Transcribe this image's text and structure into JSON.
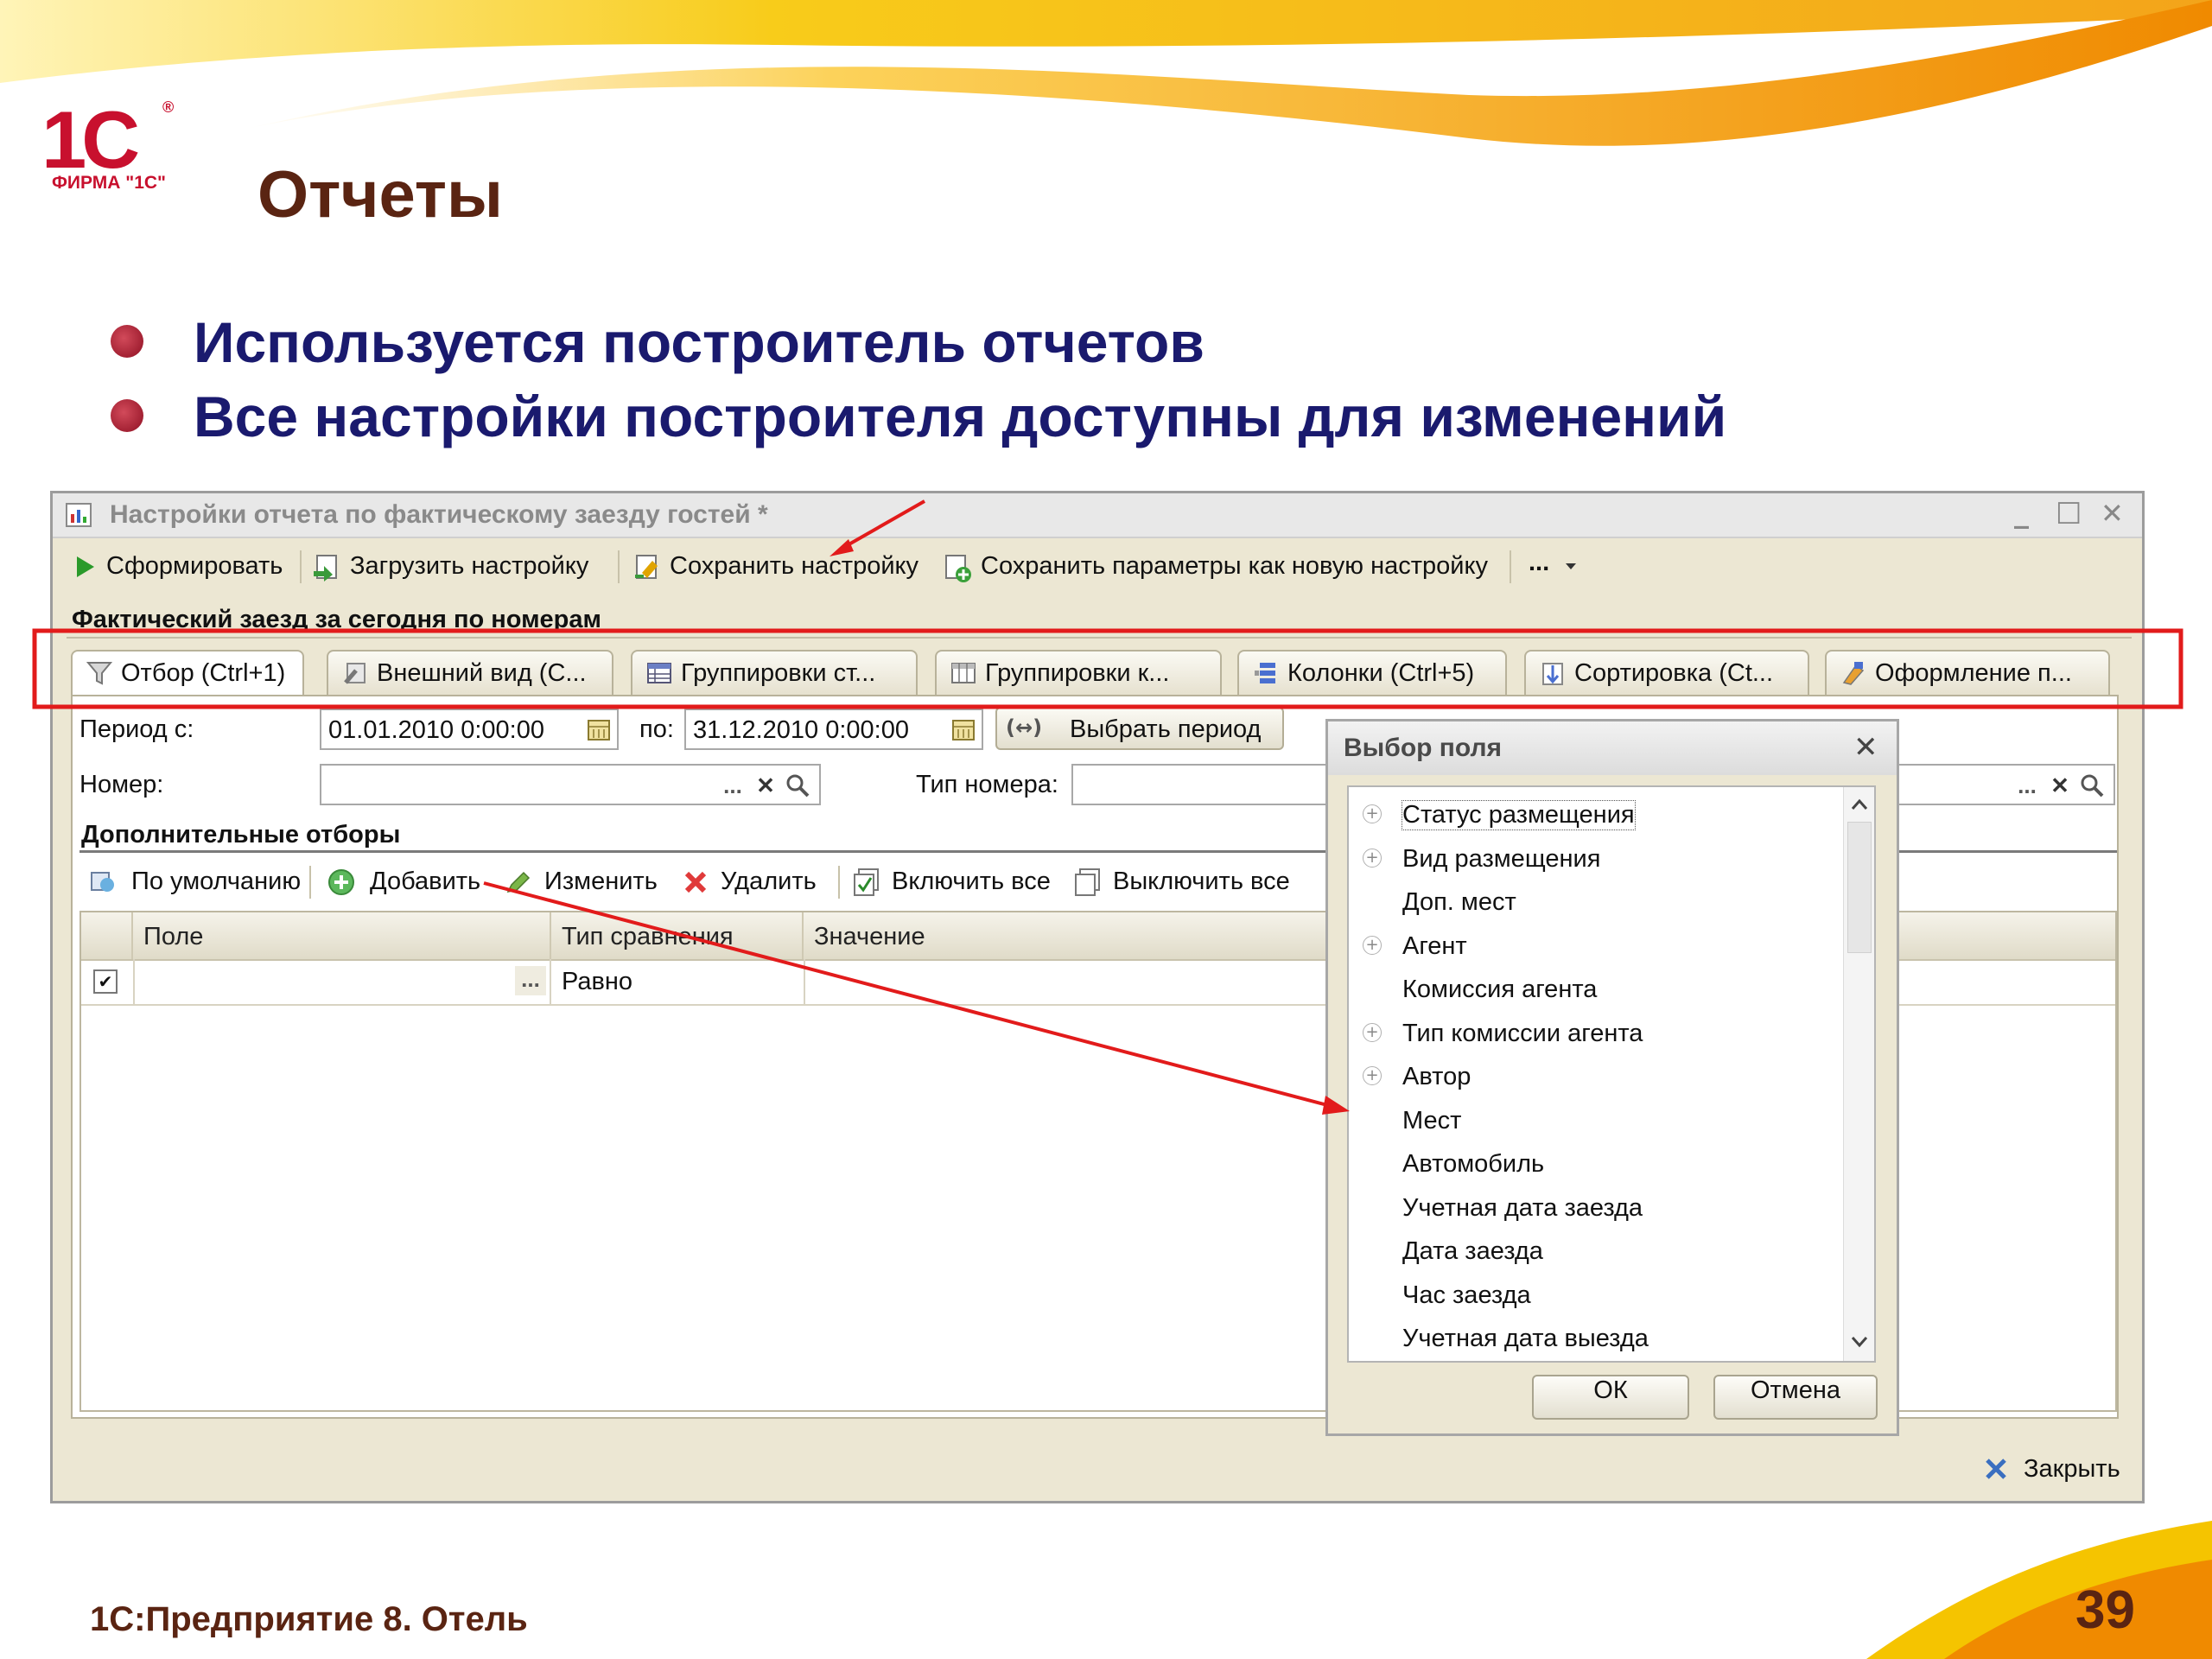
{
  "slide": {
    "logo_main": "1С",
    "logo_reg": "®",
    "logo_firm": "ФИРМА \"1С\"",
    "title": "Отчеты",
    "bullets": [
      "Используется построитель отчетов",
      "Все настройки построителя доступны для изменений"
    ],
    "footer": "1С:Предприятие 8. Отель",
    "page_number": "39"
  },
  "window": {
    "title": "Настройки отчета по фактическому заезду гостей *",
    "controls": {
      "minimize": "_",
      "maximize": "☐",
      "close": "✕"
    },
    "toolbar": {
      "generate": "Сформировать",
      "load": "Загрузить настройку",
      "save": "Сохранить настройку",
      "save_as": "Сохранить параметры как новую настройку",
      "more": "..."
    },
    "report_name": "Фактический заезд за сегодня по номерам",
    "tabs": [
      "Отбор (Ctrl+1)",
      "Внешний вид (C...",
      "Группировки ст...",
      "Группировки к...",
      "Колонки (Ctrl+5)",
      "Сортировка (Ct...",
      "Оформление п..."
    ],
    "filters": {
      "period_from_label": "Период с:",
      "period_from_value": "01.01.2010  0:00:00",
      "period_to_label": "по:",
      "period_to_value": "31.12.2010  0:00:00",
      "choose_period": "Выбрать период",
      "period_button_icon": "(↔)",
      "room_label": "Номер:",
      "room_value": "",
      "room_type_label": "Тип номера:",
      "room_type_value": "",
      "ellipsis": "...",
      "clear": "✕"
    },
    "additional": {
      "header": "Дополнительные отборы",
      "buttons": [
        "По умолчанию",
        "Добавить",
        "Изменить",
        "Удалить",
        "Включить все",
        "Выключить все"
      ]
    },
    "grid": {
      "columns": [
        "Поле",
        "Тип сравнения",
        "Значение"
      ],
      "rows": [
        {
          "checked": "✔",
          "field": "",
          "ellipsis": "...",
          "comparison": "Равно",
          "value": ""
        }
      ]
    },
    "close_button": "Закрыть"
  },
  "dialog": {
    "title": "Выбор поля",
    "close": "✕",
    "items": [
      {
        "label": "Статус размещения",
        "expandable": true
      },
      {
        "label": "Вид размещения",
        "expandable": true
      },
      {
        "label": "Доп. мест",
        "expandable": false
      },
      {
        "label": "Агент",
        "expandable": true
      },
      {
        "label": "Комиссия агента",
        "expandable": false
      },
      {
        "label": "Тип комиссии агента",
        "expandable": true
      },
      {
        "label": "Автор",
        "expandable": true
      },
      {
        "label": "Мест",
        "expandable": false
      },
      {
        "label": "Автомобиль",
        "expandable": false
      },
      {
        "label": "Учетная дата заезда",
        "expandable": false
      },
      {
        "label": "Дата заезда",
        "expandable": false
      },
      {
        "label": "Час заезда",
        "expandable": false
      },
      {
        "label": "Учетная дата выезда",
        "expandable": false
      }
    ],
    "expand_glyph": "+",
    "ok": "ОК",
    "cancel": "Отмена"
  },
  "colors": {
    "accent_red": "#e21b1b",
    "title_brown": "#5a2412",
    "bullet_blue": "#1a1a6e",
    "logo_red": "#c8102e",
    "swoosh_yellow": "#f5c400",
    "swoosh_orange": "#f08a00"
  }
}
